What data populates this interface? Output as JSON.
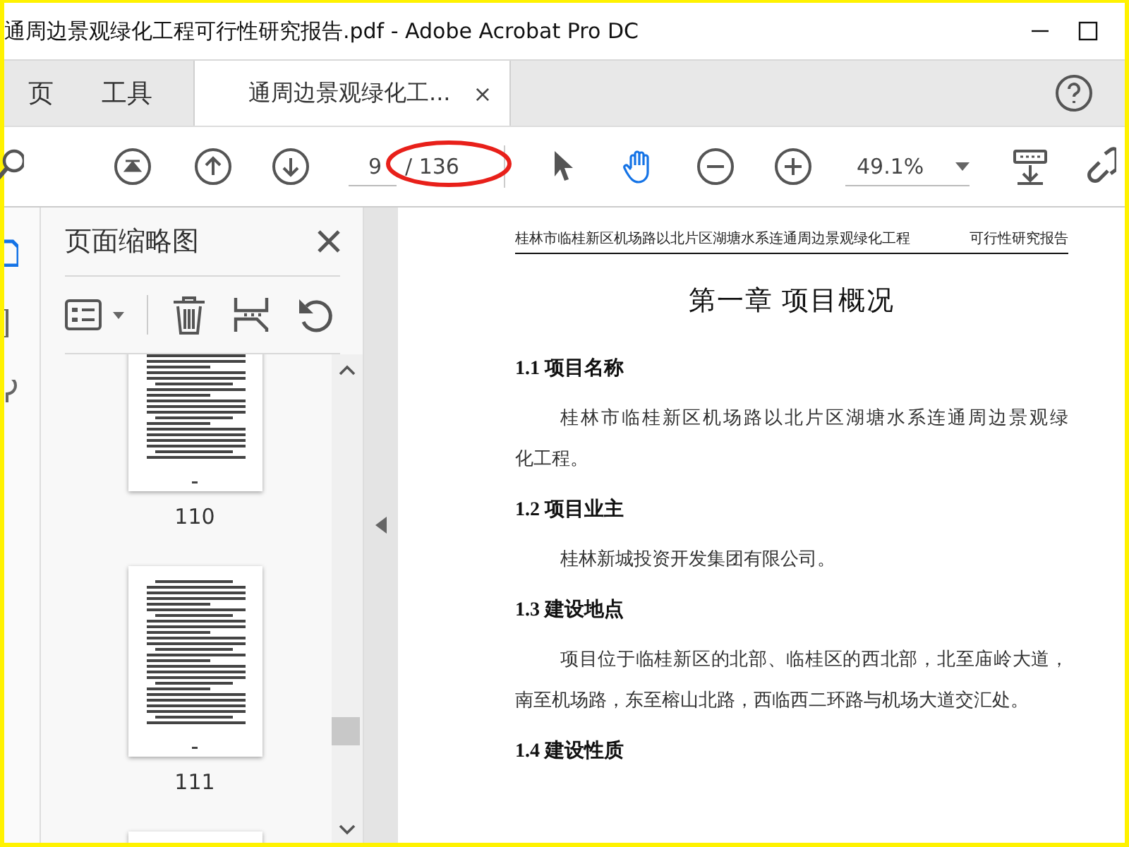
{
  "window": {
    "title": "通周边景观绿化工程可行性研究报告.pdf - Adobe Acrobat Pro DC"
  },
  "tabs": [
    {
      "label": "页",
      "selected": false
    },
    {
      "label": "工具",
      "selected": false
    },
    {
      "label": "通周边景观绿化工...",
      "selected": true,
      "close": "×"
    }
  ],
  "toolbar": {
    "page_field": {
      "value": "9"
    },
    "page_total": "/ 136",
    "zoom_field": {
      "value": "49.1%"
    },
    "tools": [
      {
        "kind": "select",
        "selected": false
      },
      {
        "kind": "hand",
        "selected": true
      }
    ]
  },
  "markup": {
    "kind": "ellipse"
  },
  "nav_rail": [
    {
      "selected": true
    },
    {
      "selected": false
    },
    {
      "selected": false
    }
  ],
  "thumbnails_panel": {
    "title": "页面缩略图",
    "pages": [
      {
        "kind": "page",
        "label": "110"
      },
      {
        "kind": "page",
        "label": "111"
      },
      {
        "kind": "partial"
      }
    ]
  },
  "document": {
    "header_left": "桂林市临桂新区机场路以北片区湖塘水系连通周边景观绿化工程",
    "header_right": "可行性研究报告",
    "chapter_title": "第一章  项目概况",
    "sections": [
      {
        "heading": "1.1 项目名称",
        "lines": [
          "桂林市临桂新区机场路以北片区湖塘水系连通周边景观绿",
          "化工程。"
        ]
      },
      {
        "heading": "1.2 项目业主",
        "lines": [
          "桂林新城投资开发集团有限公司。"
        ]
      },
      {
        "heading": "1.3 建设地点",
        "lines": [
          "项目位于临桂新区的北部、临桂区的西北部，北至庙岭大道，",
          "南至机场路，东至榕山北路，西临西二环路与机场大道交汇处。"
        ]
      },
      {
        "heading": "1.4 建设性质"
      }
    ]
  }
}
